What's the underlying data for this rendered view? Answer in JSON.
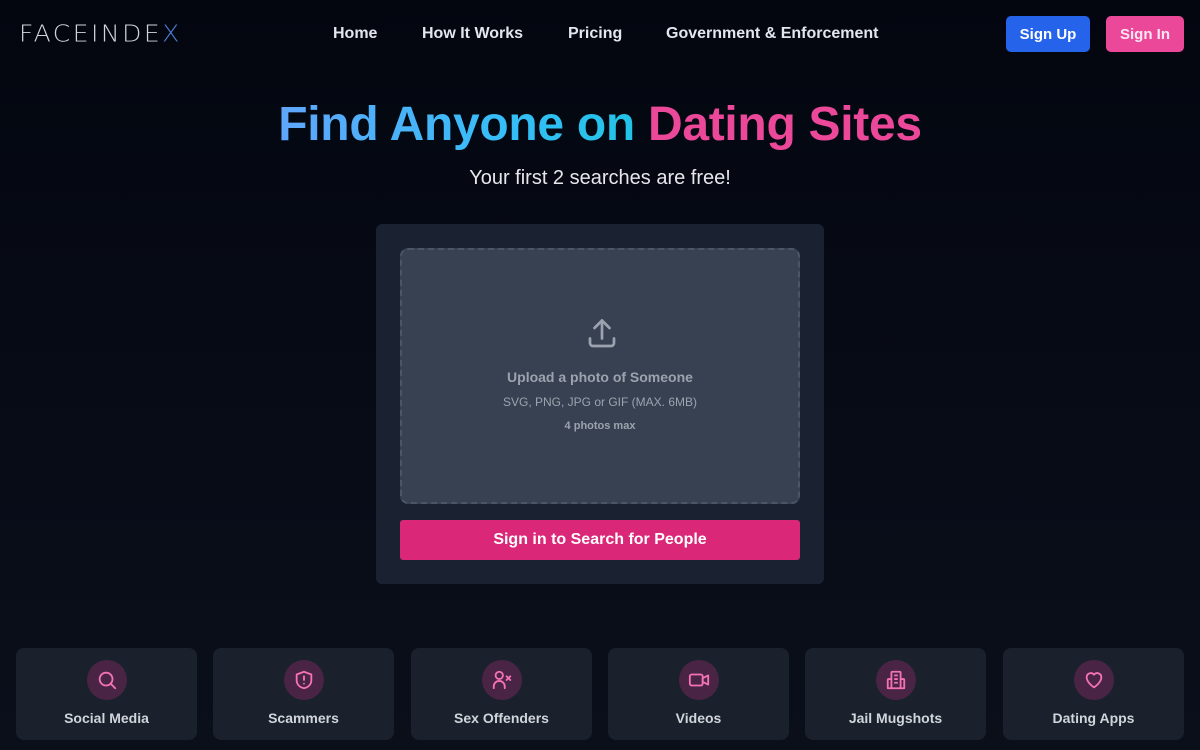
{
  "header": {
    "logo": {
      "main": "FACEINDE",
      "accent": "X"
    },
    "nav": [
      {
        "label": "Home"
      },
      {
        "label": "How It Works"
      },
      {
        "label": "Pricing"
      },
      {
        "label": "Government & Enforcement"
      }
    ],
    "sign_up_label": "Sign Up",
    "sign_in_label": "Sign In"
  },
  "hero": {
    "title_part1": "Find Anyone on",
    "title_part2": "Dating Sites",
    "subtitle": "Your first 2 searches are free!"
  },
  "upload": {
    "icon": "upload-icon",
    "title": "Upload a photo of Someone",
    "formats": "SVG, PNG, JPG or GIF (MAX. 6MB)",
    "max_photos": "4 photos max",
    "button_label": "Sign in to Search for People"
  },
  "categories": [
    {
      "label": "Social Media",
      "icon": "search-icon"
    },
    {
      "label": "Scammers",
      "icon": "shield-alert-icon"
    },
    {
      "label": "Sex Offenders",
      "icon": "user-x-icon"
    },
    {
      "label": "Videos",
      "icon": "video-icon"
    },
    {
      "label": "Jail Mugshots",
      "icon": "building-icon"
    },
    {
      "label": "Dating Apps",
      "icon": "heart-icon"
    }
  ],
  "colors": {
    "background": "#05080f",
    "brand_blue": "#2563eb",
    "brand_pink": "#ec4899",
    "cta_pink": "#db2777",
    "panel": "#1a2130",
    "dropzone": "#374151",
    "icon_pink": "#f472b6",
    "logo_accent": "#4a7fd0"
  }
}
